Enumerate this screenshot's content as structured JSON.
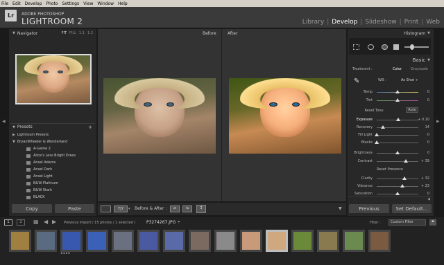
{
  "menu": [
    "File",
    "Edit",
    "Develop",
    "Photo",
    "Settings",
    "View",
    "Window",
    "Help"
  ],
  "app": {
    "logo": "Lr",
    "brand_top": "ADOBE PHOTOSHOP",
    "brand_bottom": "LIGHTROOM 2"
  },
  "modules": [
    {
      "label": "Library"
    },
    {
      "label": "Develop"
    },
    {
      "label": "Slideshow"
    },
    {
      "label": "Print"
    },
    {
      "label": "Web"
    }
  ],
  "navigator": {
    "title": "Navigator",
    "opts": [
      "FIT",
      "FILL",
      "1:1",
      "1:2"
    ]
  },
  "presets": {
    "title": "Presets",
    "plus": "+",
    "items": [
      "Lightroom Presets",
      "BryanWheeler & Wonderland",
      "A-Game 2",
      "Alice's Less Bright Dress",
      "Ansel Adams",
      "Ansel Dark",
      "Ansel Light",
      "B&W Platinum",
      "B&W Stark",
      "BLACK"
    ]
  },
  "left_buttons": {
    "copy": "Copy",
    "paste": "Paste"
  },
  "view": {
    "before": "Before",
    "after": "After"
  },
  "toolbar": {
    "label": "Before & After :",
    "mode": "Y|Y"
  },
  "histogram": {
    "title": "Histogram"
  },
  "basic": {
    "title": "Basic",
    "treatment_label": "Treatment :",
    "color": "Color",
    "grayscale": "Grayscale",
    "wb_label": "WB :",
    "wb_value": "As Shot ÷",
    "tone_title": "Reset Tone",
    "auto": "Auto",
    "presence_title": "Reset Presence",
    "rows": [
      {
        "label": "Temp",
        "value": "0",
        "knob": 0.5
      },
      {
        "label": "Tint",
        "value": "0",
        "knob": 0.5
      },
      {
        "label": "Exposure",
        "value": "+ 0.10",
        "knob": 0.52
      },
      {
        "label": "Recovery",
        "value": "14",
        "knob": 0.15
      },
      {
        "label": "Fill Light",
        "value": "0",
        "knob": 0.0
      },
      {
        "label": "Blacks",
        "value": "0",
        "knob": 0.0
      },
      {
        "label": "Brightness",
        "value": "0",
        "knob": 0.5
      },
      {
        "label": "Contrast",
        "value": "+ 39",
        "knob": 0.7
      },
      {
        "label": "Clarity",
        "value": "+ 32",
        "knob": 0.66
      },
      {
        "label": "Vibrance",
        "value": "+ 23",
        "knob": 0.62
      },
      {
        "label": "Saturation",
        "value": "0",
        "knob": 0.5
      }
    ]
  },
  "right_buttons": {
    "previous": "Previous",
    "set_default": "Set Default..."
  },
  "filmstrip": {
    "pages": [
      "1",
      "2"
    ],
    "path": "Previous Import / 15 photos / 1 selected /",
    "file": "P3274267.JPG ÷",
    "filter_label": "Filter :",
    "filter_value": "Custom Filter",
    "stars": "★★★★"
  },
  "colors": {
    "accent": "#ffffff",
    "panel": "#282828",
    "selected_thumb": "#bdbdbd"
  }
}
